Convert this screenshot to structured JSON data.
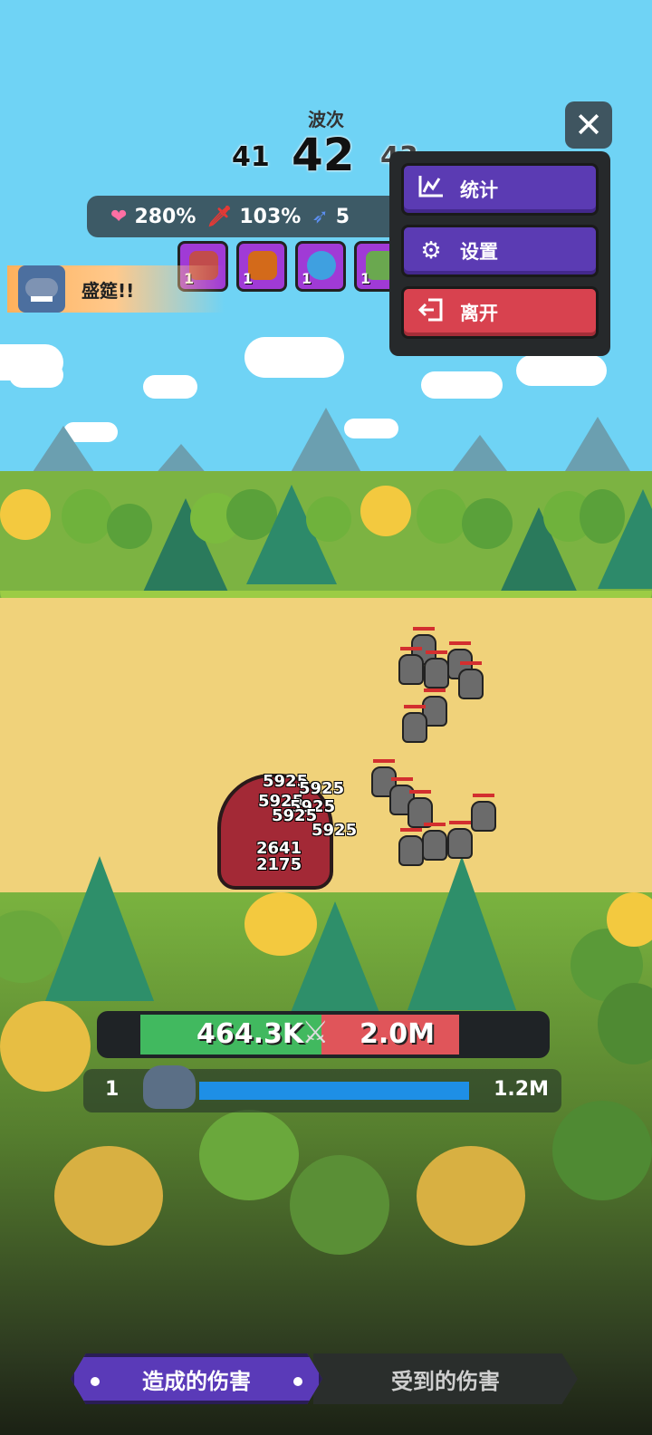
{
  "wave": {
    "label": "波次",
    "prev": "41",
    "current": "42",
    "next": "43"
  },
  "stats": [
    {
      "icon": "heart-icon",
      "value": "280%"
    },
    {
      "icon": "sword-icon",
      "value": "103%"
    },
    {
      "icon": "arrow-icon",
      "value": "5"
    }
  ],
  "cards": [
    {
      "level": "1",
      "color": "#c14c4c"
    },
    {
      "level": "1",
      "color": "#d36a1a"
    },
    {
      "level": "1",
      "color": "#3fa0e0"
    },
    {
      "level": "1",
      "color": "#6aa84f"
    }
  ],
  "banner": {
    "text": "盛筵!!"
  },
  "menu": {
    "close_label": "✕",
    "items": [
      {
        "label": "统计",
        "icon": "chart-icon"
      },
      {
        "label": "设置",
        "icon": "gear-icon"
      },
      {
        "label": "离开",
        "icon": "exit-icon"
      }
    ]
  },
  "battle": {
    "damage_numbers": [
      "5925",
      "5925",
      "5925",
      "5925",
      "5925",
      "5925",
      "2641",
      "2175"
    ]
  },
  "damage_bar": {
    "dealt": "464.3K",
    "taken": "2.0M"
  },
  "progress": {
    "left": "1",
    "right": "1.2M"
  },
  "tabs": {
    "active": "造成的伤害",
    "inactive": "受到的伤害"
  },
  "colors": {
    "accent": "#5a3ab8",
    "danger": "#d8424f",
    "green": "#41b95f",
    "blue": "#1e8fe6"
  }
}
